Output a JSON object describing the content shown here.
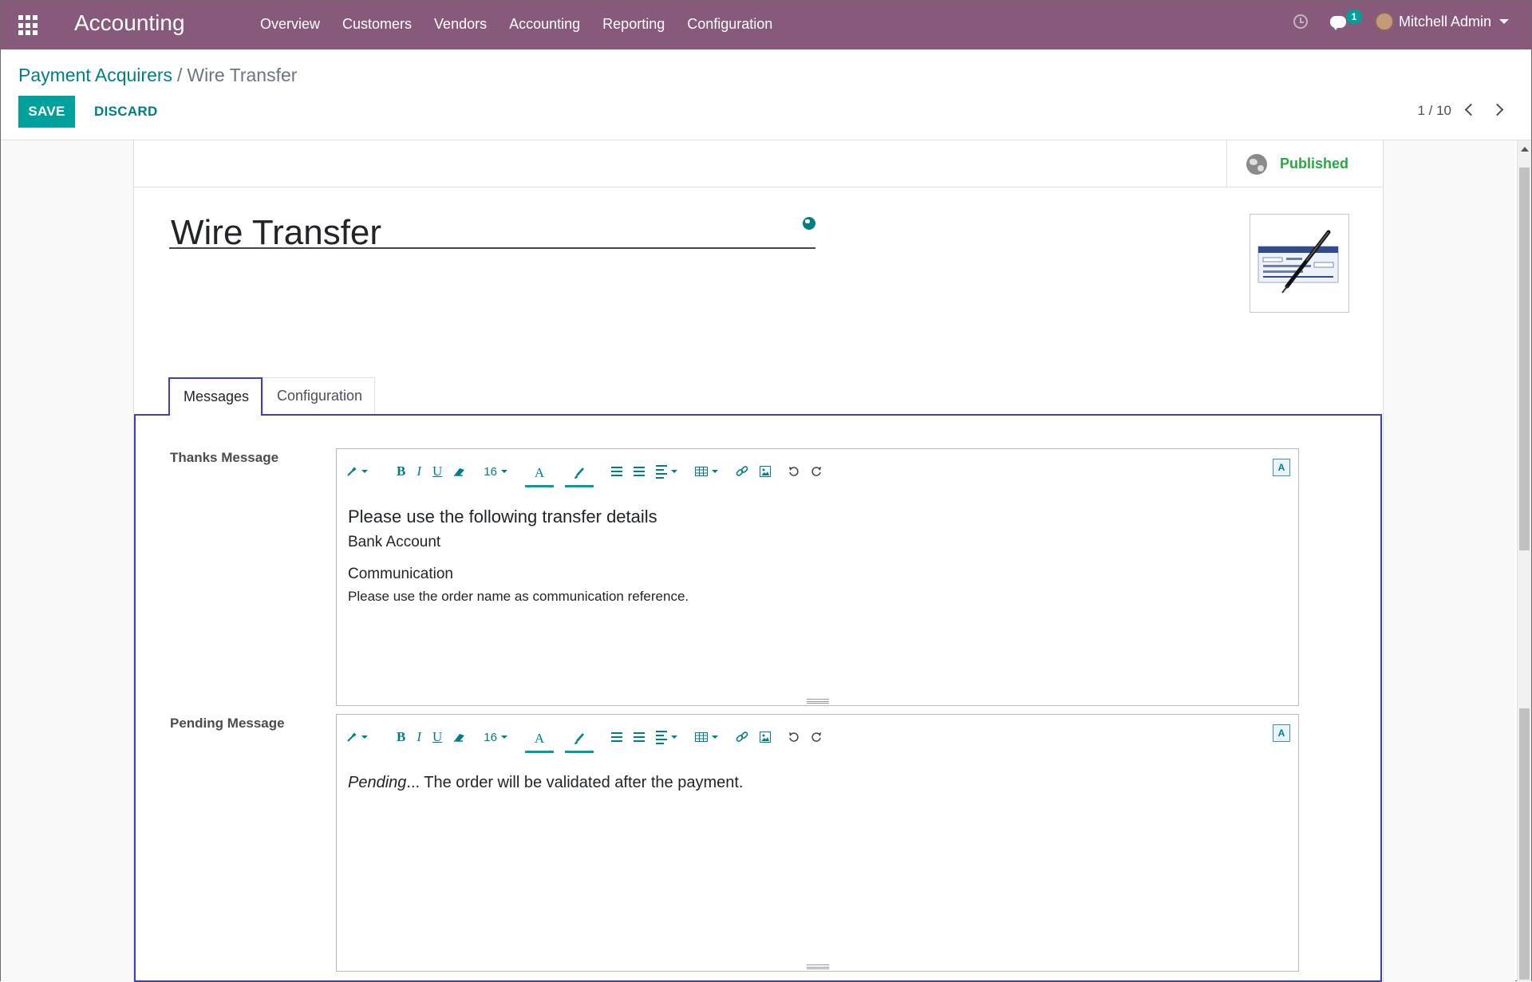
{
  "navbar": {
    "app_name": "Accounting",
    "menu": [
      "Overview",
      "Customers",
      "Vendors",
      "Accounting",
      "Reporting",
      "Configuration"
    ],
    "messages_badge": "1",
    "user_name": "Mitchell Admin"
  },
  "breadcrumb": {
    "parent": "Payment Acquirers",
    "separator": "/",
    "current": "Wire Transfer"
  },
  "actions": {
    "save": "SAVE",
    "discard": "DISCARD"
  },
  "pager": {
    "value": "1 / 10"
  },
  "form": {
    "published_label": "Published",
    "name": "Wire Transfer",
    "tabs": [
      "Messages",
      "Configuration"
    ],
    "thanks_label": "Thanks Message",
    "pending_label": "Pending Message",
    "font_size": "16",
    "thanks_lines": [
      "Please use the following transfer details",
      "Bank Account",
      "Communication",
      "Please use the order name as communication reference."
    ],
    "pending_italic": "Pending",
    "pending_rest": "... The order will be validated after the payment."
  },
  "colors": {
    "navbar": "#875a7b",
    "primary": "#00a09d",
    "link": "#017e84",
    "published": "#28a745",
    "active_tab_border": "#3d3dbd"
  },
  "icons": [
    "apps-grid-icon",
    "clock-icon",
    "chat-icon",
    "chevron-left-icon",
    "chevron-right-icon",
    "globe-icon",
    "magic-wand-icon",
    "eraser-icon",
    "unordered-list-icon",
    "ordered-list-icon",
    "align-icon",
    "table-icon",
    "link-icon",
    "image-icon",
    "undo-icon",
    "redo-icon",
    "translate-icon"
  ]
}
